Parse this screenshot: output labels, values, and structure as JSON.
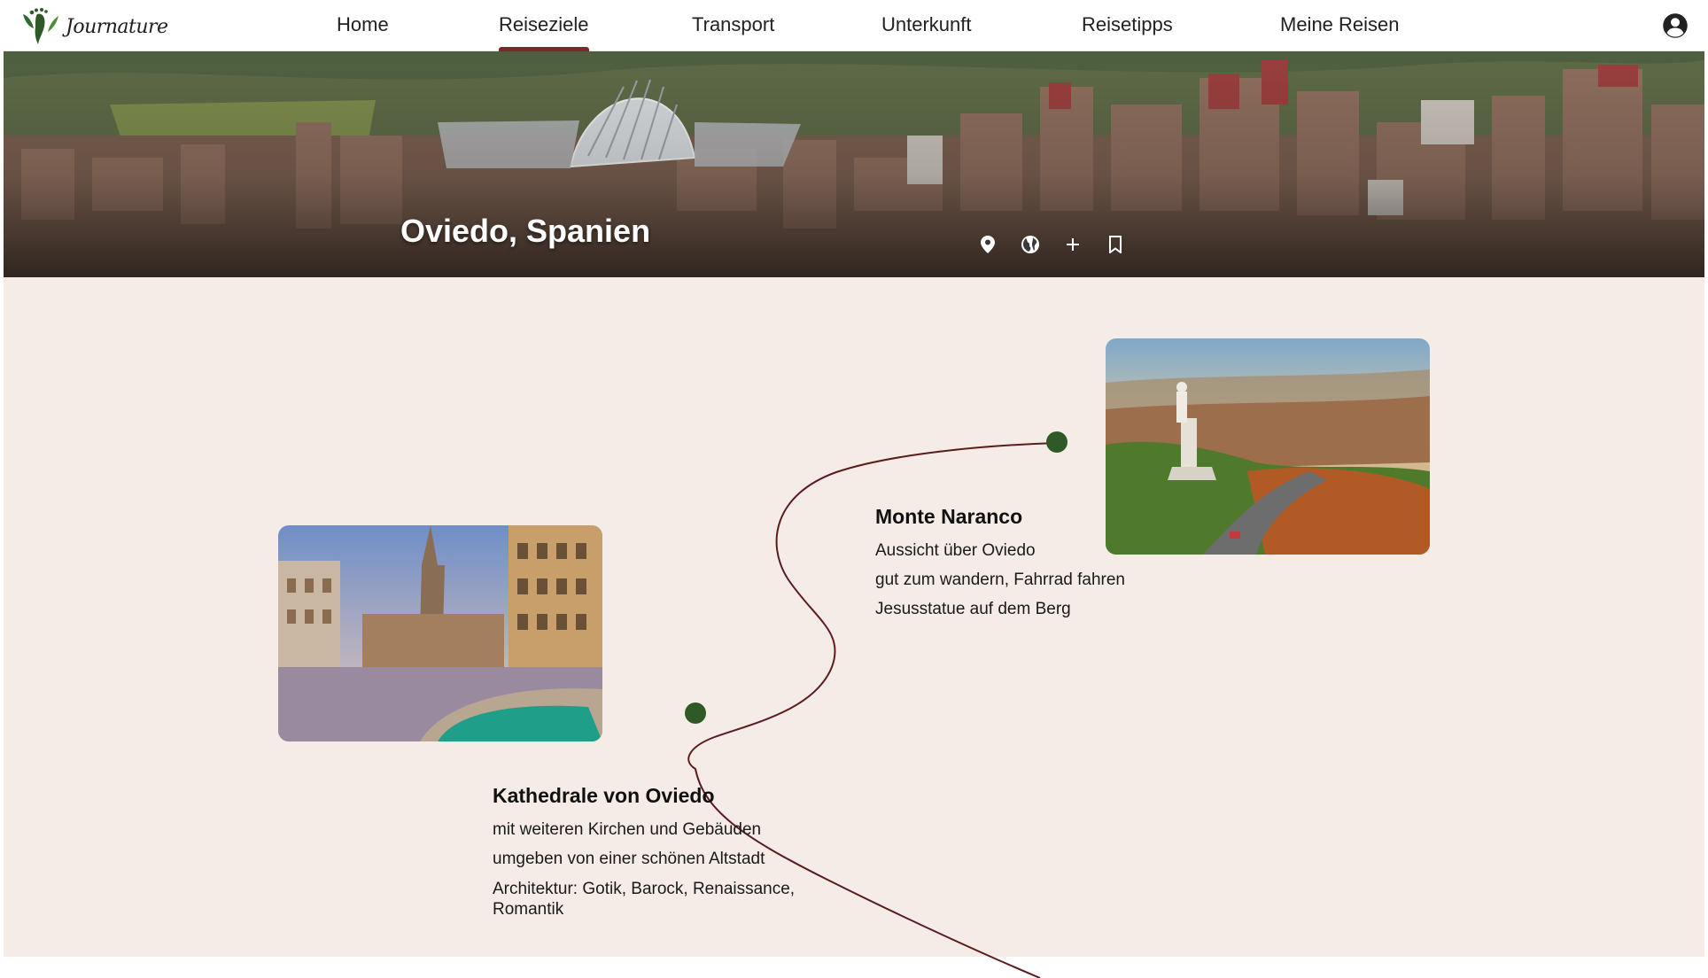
{
  "app": {
    "logo_text": "Journature",
    "account_icon": "account-circle-icon"
  },
  "nav": {
    "items": [
      {
        "label": "Home"
      },
      {
        "label": "Reiseziele"
      },
      {
        "label": "Transport"
      },
      {
        "label": "Unterkunft"
      },
      {
        "label": "Reisetipps"
      },
      {
        "label": "Meine Reisen"
      }
    ],
    "active": "Reiseziele"
  },
  "hero": {
    "title": "Oviedo, Spanien",
    "icons": [
      "location-pin-icon",
      "globe-icon",
      "plus-icon",
      "bookmark-icon"
    ]
  },
  "stops": {
    "naranco": {
      "title": "Monte Naranco",
      "lines": [
        "Aussicht über Oviedo",
        "gut zum wandern, Fahrrad fahren",
        "Jesusstatue auf dem Berg"
      ]
    },
    "kathedrale": {
      "title": "Kathedrale von Oviedo",
      "lines": [
        "mit weiteren Kirchen und Gebäuden",
        "umgeben von einer schönen Altstadt",
        "Architektur: Gotik, Barock, Renaissance, Romantik"
      ]
    }
  },
  "colors": {
    "accent": "#7a2a2a",
    "path": "#5a1c1c",
    "marker": "#2f5a27",
    "content_bg": "#f5ece7"
  }
}
